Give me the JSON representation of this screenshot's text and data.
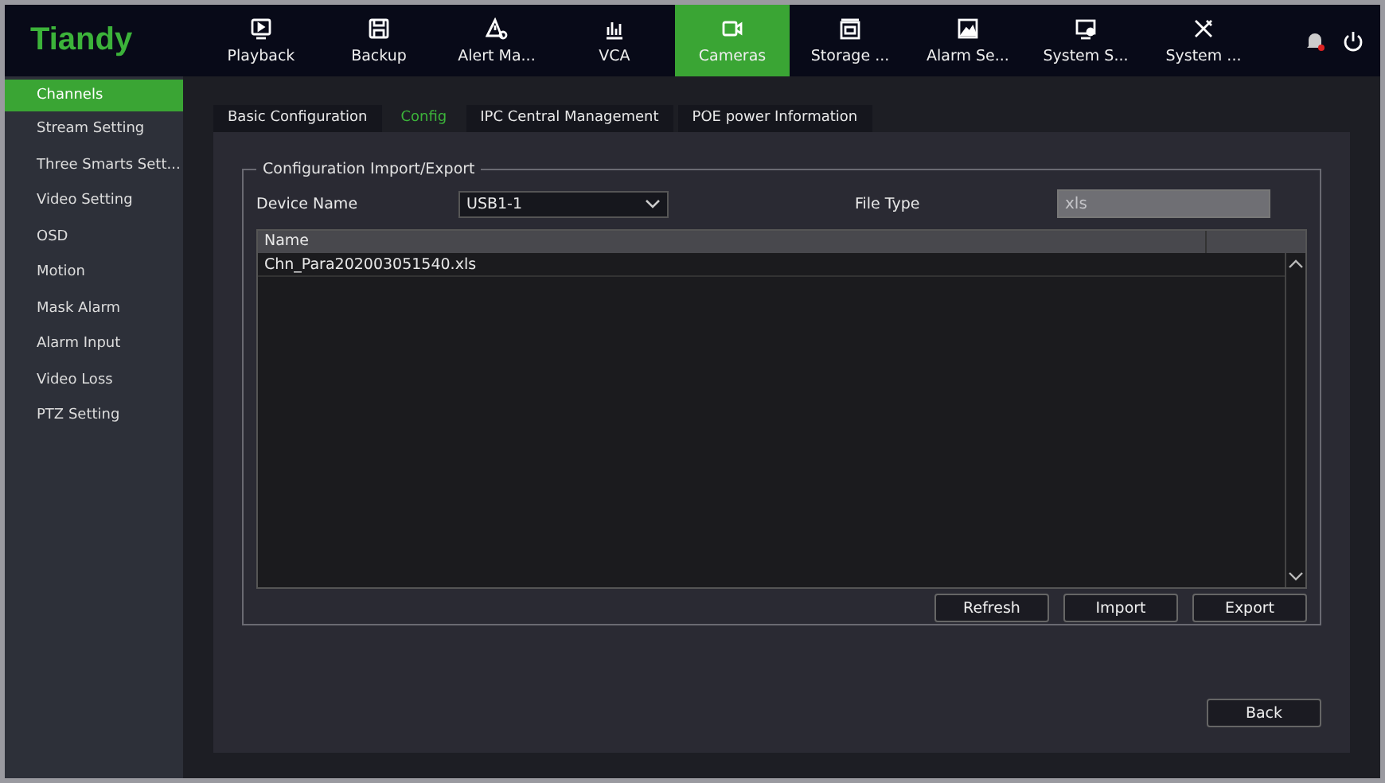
{
  "logo": "Tiandy",
  "nav": [
    {
      "label": "Playback",
      "selected": false
    },
    {
      "label": "Backup",
      "selected": false
    },
    {
      "label": "Alert Ma...",
      "selected": false
    },
    {
      "label": "VCA",
      "selected": false
    },
    {
      "label": "Cameras",
      "selected": true
    },
    {
      "label": "Storage ...",
      "selected": false
    },
    {
      "label": "Alarm Se...",
      "selected": false
    },
    {
      "label": "System S...",
      "selected": false
    },
    {
      "label": "System ...",
      "selected": false
    }
  ],
  "sidebar": {
    "items": [
      {
        "label": "Channels",
        "selected": true
      },
      {
        "label": "Stream Setting",
        "selected": false
      },
      {
        "label": "Three Smarts Sett...",
        "selected": false
      },
      {
        "label": "Video Setting",
        "selected": false
      },
      {
        "label": "OSD",
        "selected": false
      },
      {
        "label": "Motion",
        "selected": false
      },
      {
        "label": "Mask Alarm",
        "selected": false
      },
      {
        "label": "Alarm Input",
        "selected": false
      },
      {
        "label": "Video Loss",
        "selected": false
      },
      {
        "label": "PTZ Setting",
        "selected": false
      }
    ]
  },
  "tabs": [
    {
      "label": "Basic Configuration",
      "selected": false
    },
    {
      "label": "Config",
      "selected": true
    },
    {
      "label": "IPC Central Management",
      "selected": false
    },
    {
      "label": "POE power Information",
      "selected": false
    }
  ],
  "group": {
    "title": "Configuration Import/Export",
    "device_name": {
      "label": "Device Name",
      "value": "USB1-1"
    },
    "file_type": {
      "label": "File Type",
      "value": "xls",
      "disabled": true
    },
    "table": {
      "columns": [
        "Name"
      ],
      "rows": [
        [
          "Chn_Para202003051540.xls"
        ]
      ]
    },
    "buttons": [
      "Refresh",
      "Import",
      "Export"
    ]
  },
  "back_button": "Back"
}
